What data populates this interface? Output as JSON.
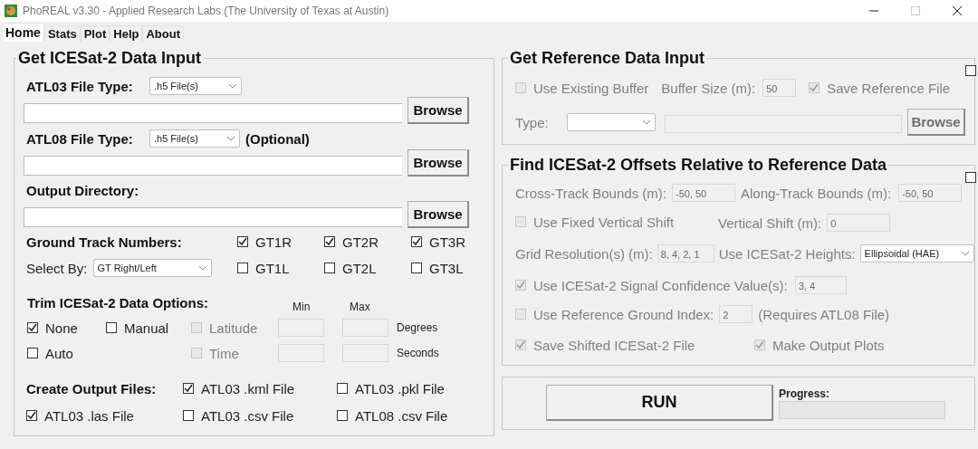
{
  "window": {
    "title": "PhoREAL v3.30 - Applied Research Labs (The University of Texas at Austin)"
  },
  "tabs": [
    {
      "label": "Home",
      "selected": true
    },
    {
      "label": "Stats",
      "selected": false
    },
    {
      "label": "Plot",
      "selected": false
    },
    {
      "label": "Help",
      "selected": false
    },
    {
      "label": "About",
      "selected": false
    }
  ],
  "icesat_input": {
    "title": "Get ICESat-2 Data Input",
    "atl03": {
      "label": "ATL03 File Type:",
      "value": ".h5 File(s)",
      "button": "Browse"
    },
    "atl08": {
      "label": "ATL08 File Type:",
      "value": ".h5 File(s)",
      "note": "(Optional)",
      "button": "Browse"
    },
    "output": {
      "label": "Output Directory:",
      "button": "Browse"
    },
    "ground_tracks": {
      "label": "Ground Track Numbers:",
      "select_label": "Select By:",
      "select_value": "GT Right/Left",
      "checkboxes": [
        {
          "label": "GT1R",
          "checked": true
        },
        {
          "label": "GT2R",
          "checked": true
        },
        {
          "label": "GT3R",
          "checked": true
        },
        {
          "label": "GT1L",
          "checked": false
        },
        {
          "label": "GT2L",
          "checked": false
        },
        {
          "label": "GT3L",
          "checked": false
        }
      ]
    },
    "trim": {
      "label": "Trim ICESat-2 Data Options:",
      "min_label": "Min",
      "max_label": "Max",
      "rows": [
        {
          "choices": [
            {
              "label": "None",
              "checked": true
            },
            {
              "label": "Manual",
              "checked": false
            }
          ],
          "bound": {
            "label": "Latitude",
            "checked": false,
            "disabled": true
          },
          "unit": "Degrees"
        },
        {
          "choices": [
            {
              "label": "Auto",
              "checked": false
            }
          ],
          "bound": {
            "label": "Time",
            "checked": false,
            "disabled": true
          },
          "unit": "Seconds"
        }
      ]
    },
    "output_files": {
      "label": "Create Output Files:",
      "checkboxes": [
        {
          "label": "ATL03 .kml File",
          "checked": true
        },
        {
          "label": "ATL03 .pkl File",
          "checked": false
        },
        {
          "label": "ATL03 .las File",
          "checked": true
        },
        {
          "label": "ATL03 .csv File",
          "checked": false
        },
        {
          "label": "ATL08 .csv File",
          "checked": false
        }
      ]
    }
  },
  "reference": {
    "title": "Get Reference Data Input",
    "checked": false,
    "use_existing_buffer": {
      "label": "Use Existing Buffer",
      "checked": false
    },
    "buffer_size": {
      "label": "Buffer Size (m):",
      "value": "50"
    },
    "save_reference": {
      "label": "Save Reference File",
      "checked": true
    },
    "type_label": "Type:",
    "button": "Browse"
  },
  "offsets": {
    "title": "Find ICESat-2 Offsets Relative to Reference Data",
    "checked": false,
    "cross_track": {
      "label": "Cross-Track Bounds (m):",
      "value": "-50, 50"
    },
    "along_track": {
      "label": "Along-Track Bounds (m):",
      "value": "-50, 50"
    },
    "fixed_shift": {
      "label": "Use Fixed Vertical Shift",
      "checked": false
    },
    "vertical_shift": {
      "label": "Vertical Shift (m):",
      "value": "0"
    },
    "grid_resolution": {
      "label": "Grid Resolution(s) (m):",
      "value": "8, 4, 2, 1"
    },
    "heights": {
      "label": "Use ICESat-2 Heights:",
      "value": "Ellipsoidal (HAE)"
    },
    "signal_confidence": {
      "label": "Use ICESat-2 Signal Confidence Value(s):",
      "checked": true,
      "value": "3, 4"
    },
    "ground_index": {
      "label": "Use Reference Ground Index:",
      "checked": false,
      "value": "2",
      "note": "(Requires ATL08 File)"
    },
    "save_shifted": {
      "label": "Save Shifted ICESat-2 File",
      "checked": true
    },
    "output_plots": {
      "label": "Make Output Plots",
      "checked": true
    }
  },
  "run": {
    "button": "RUN",
    "progress_label": "Progress:",
    "level": 0
  }
}
